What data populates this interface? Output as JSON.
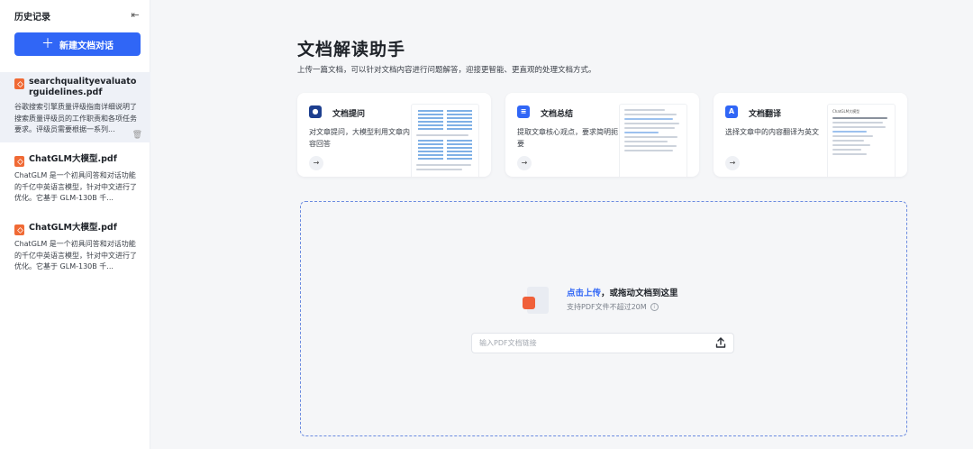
{
  "sidebar": {
    "title": "历史记录",
    "new_button": "新建文档对话",
    "items": [
      {
        "name": "searchqualityevaluatorguidelines.pdf",
        "desc": "谷歌搜索引擎质量评级指南详细说明了搜索质量评级员的工作职责和各项任务要求。评级员需要根据一系列..."
      },
      {
        "name": "ChatGLM大模型.pdf",
        "desc": "ChatGLM 是一个初具问答和对话功能的千亿中英语言模型，针对中文进行了优化。它基于 GLM-130B 千..."
      },
      {
        "name": "ChatGLM大模型.pdf",
        "desc": "ChatGLM 是一个初具问答和对话功能的千亿中英语言模型，针对中文进行了优化。它基于 GLM-130B 千..."
      }
    ]
  },
  "main": {
    "title": "文档解读助手",
    "subtitle": "上传一篇文档，可以针对文档内容进行问题解答，迎接更智能、更直观的处理文档方式。",
    "cards": [
      {
        "title": "文档提问",
        "desc": "对文章提问，大模型利用文章内容回答",
        "icon": "chat-icon",
        "color": "#1d3f8f"
      },
      {
        "title": "文档总结",
        "desc": "提取文章核心观点，要求简明扼要",
        "icon": "document-icon",
        "color": "#3066f6"
      },
      {
        "title": "文档翻译",
        "desc": "选择文章中的内容翻译为英文",
        "icon": "translate-icon",
        "color": "#3066f6"
      }
    ],
    "thumb3_title": "ChatGLM大模型",
    "upload": {
      "link_text": "点击上传",
      "rest_text": "，或拖动文档到这里",
      "hint": "支持PDF文件不超过20M",
      "url_placeholder": "输入PDF文档链接"
    }
  }
}
